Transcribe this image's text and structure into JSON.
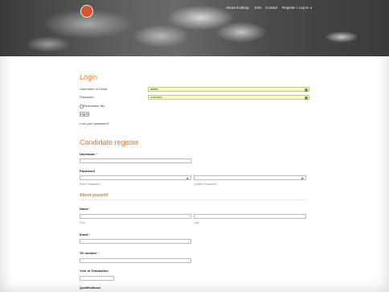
{
  "colors": {
    "accent": "#e07b2c",
    "filled_field": "#fafac4"
  },
  "nav": {
    "items": [
      "About loc8ting",
      "Jobs",
      "Contact"
    ],
    "register_label": "Register / Log In"
  },
  "login": {
    "title": "Login",
    "username_label": "Username or Email",
    "username_value": "admin",
    "password_label": "Password",
    "password_value": "••••••••••••",
    "remember_label": "Remember Me",
    "button_label": "Log In",
    "lost_password": "Lost your password?"
  },
  "register": {
    "title": "Candidate register",
    "username_label": "Username",
    "password_label": "Password",
    "enter_password_hint": "Enter Password",
    "confirm_password_hint": "Confirm Password",
    "about_title": "About yourself",
    "name_label": "Name",
    "first_hint": "First",
    "last_hint": "Last",
    "email_label": "Email",
    "tel_label": "Tel number",
    "year_label": "Year of Graduation",
    "qualifications_label": "Qualifications"
  }
}
